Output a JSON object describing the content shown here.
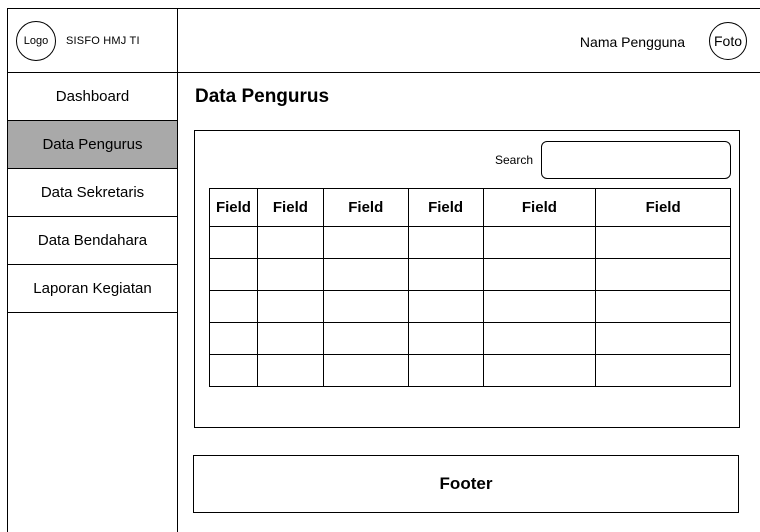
{
  "header": {
    "logo_label": "Logo",
    "app_name": "SISFO HMJ TI",
    "user_name": "Nama Pengguna",
    "avatar_label": "Foto"
  },
  "sidebar": {
    "items": [
      {
        "label": "Dashboard",
        "active": false
      },
      {
        "label": "Data Pengurus",
        "active": true
      },
      {
        "label": "Data Sekretaris",
        "active": false
      },
      {
        "label": "Data Bendahara",
        "active": false
      },
      {
        "label": "Laporan Kegiatan",
        "active": false
      }
    ],
    "active_color": "#a9a9a9"
  },
  "main": {
    "title": "Data Pengurus",
    "search": {
      "label": "Search",
      "value": "",
      "placeholder": ""
    },
    "table": {
      "headers": [
        "Field",
        "Field",
        "Field",
        "Field",
        "Field",
        "Field"
      ],
      "rows": [
        [
          "",
          "",
          "",
          "",
          "",
          ""
        ],
        [
          "",
          "",
          "",
          "",
          "",
          ""
        ],
        [
          "",
          "",
          "",
          "",
          "",
          ""
        ],
        [
          "",
          "",
          "",
          "",
          "",
          ""
        ],
        [
          "",
          "",
          "",
          "",
          "",
          ""
        ]
      ]
    }
  },
  "footer": {
    "label": "Footer"
  }
}
